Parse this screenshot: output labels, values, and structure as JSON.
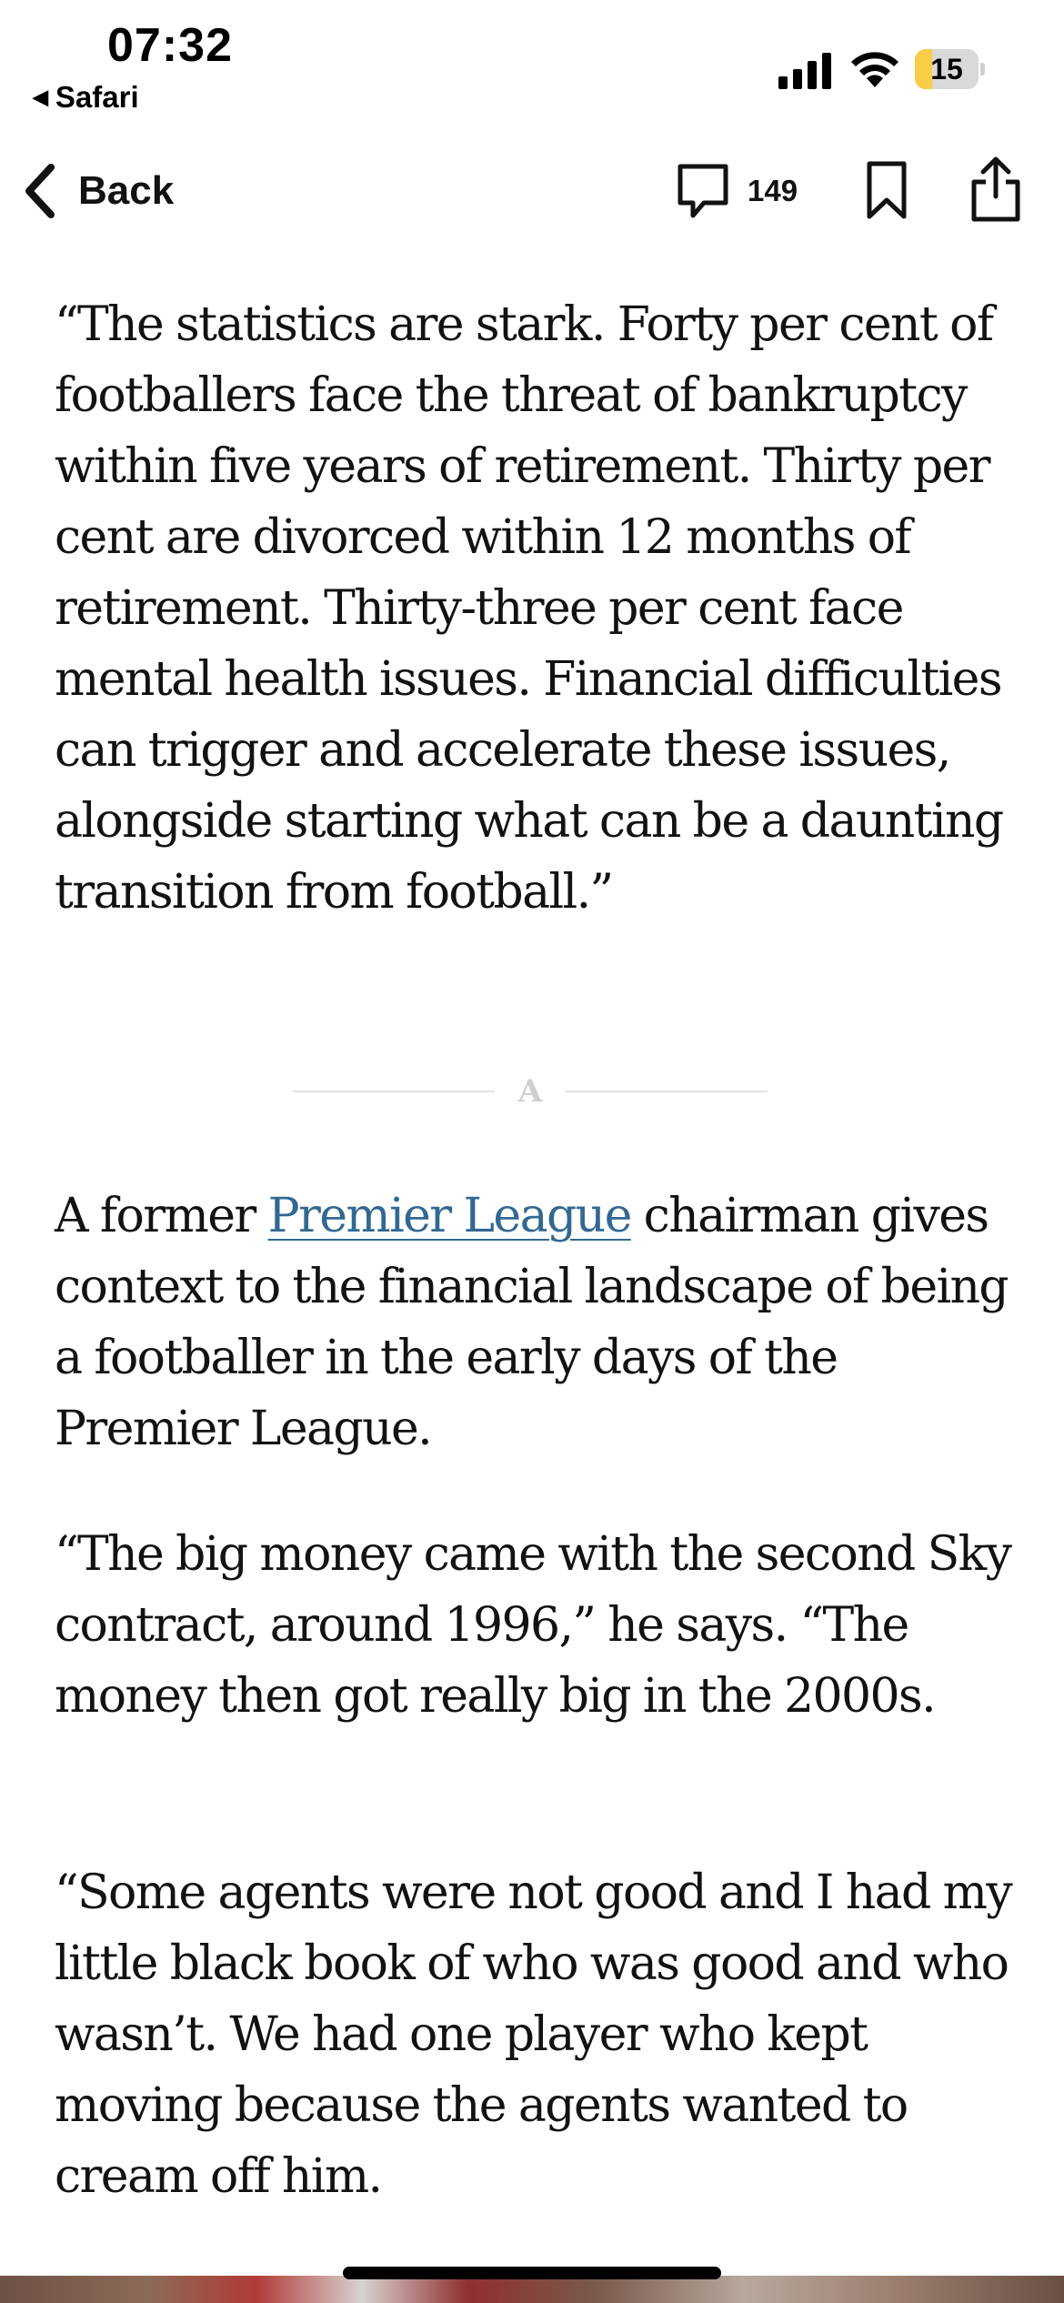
{
  "status_bar": {
    "time": "07:32",
    "back_app_label": "Safari",
    "battery_level": "15",
    "battery_fraction": 0.15,
    "battery_color": "#f7ce46"
  },
  "nav": {
    "back_label": "Back",
    "comment_count": "149",
    "icons": [
      "chevron-left-icon",
      "comment-icon",
      "bookmark-icon",
      "share-icon"
    ]
  },
  "article": {
    "quote_paragraph": "“The statistics are stark. Forty per cent of footballers face the threat of bankruptcy within five years of retirement. Thirty per cent are divorced within 12 months of retirement. Thirty-three per cent face mental health issues. Financial difficulties can trigger and accelerate these issues, alongside starting what can be a daunting transition from football.”",
    "divider_mark": "A",
    "p2_before": "A former ",
    "p2_link": "Premier League",
    "p2_after": " chairman gives context to the financial landscape of being a footballer in the early days of the Premier League.",
    "p3": "“The big money came with the second Sky contract, around 1996,” he says. “The money then got really big in the 2000s.",
    "p4": "“Some agents were not good and I had my little black book of who was good and who wasn’t. We had one player who kept moving because the agents wanted to cream off him."
  },
  "colors": {
    "link": "#326891",
    "text": "#121212"
  }
}
